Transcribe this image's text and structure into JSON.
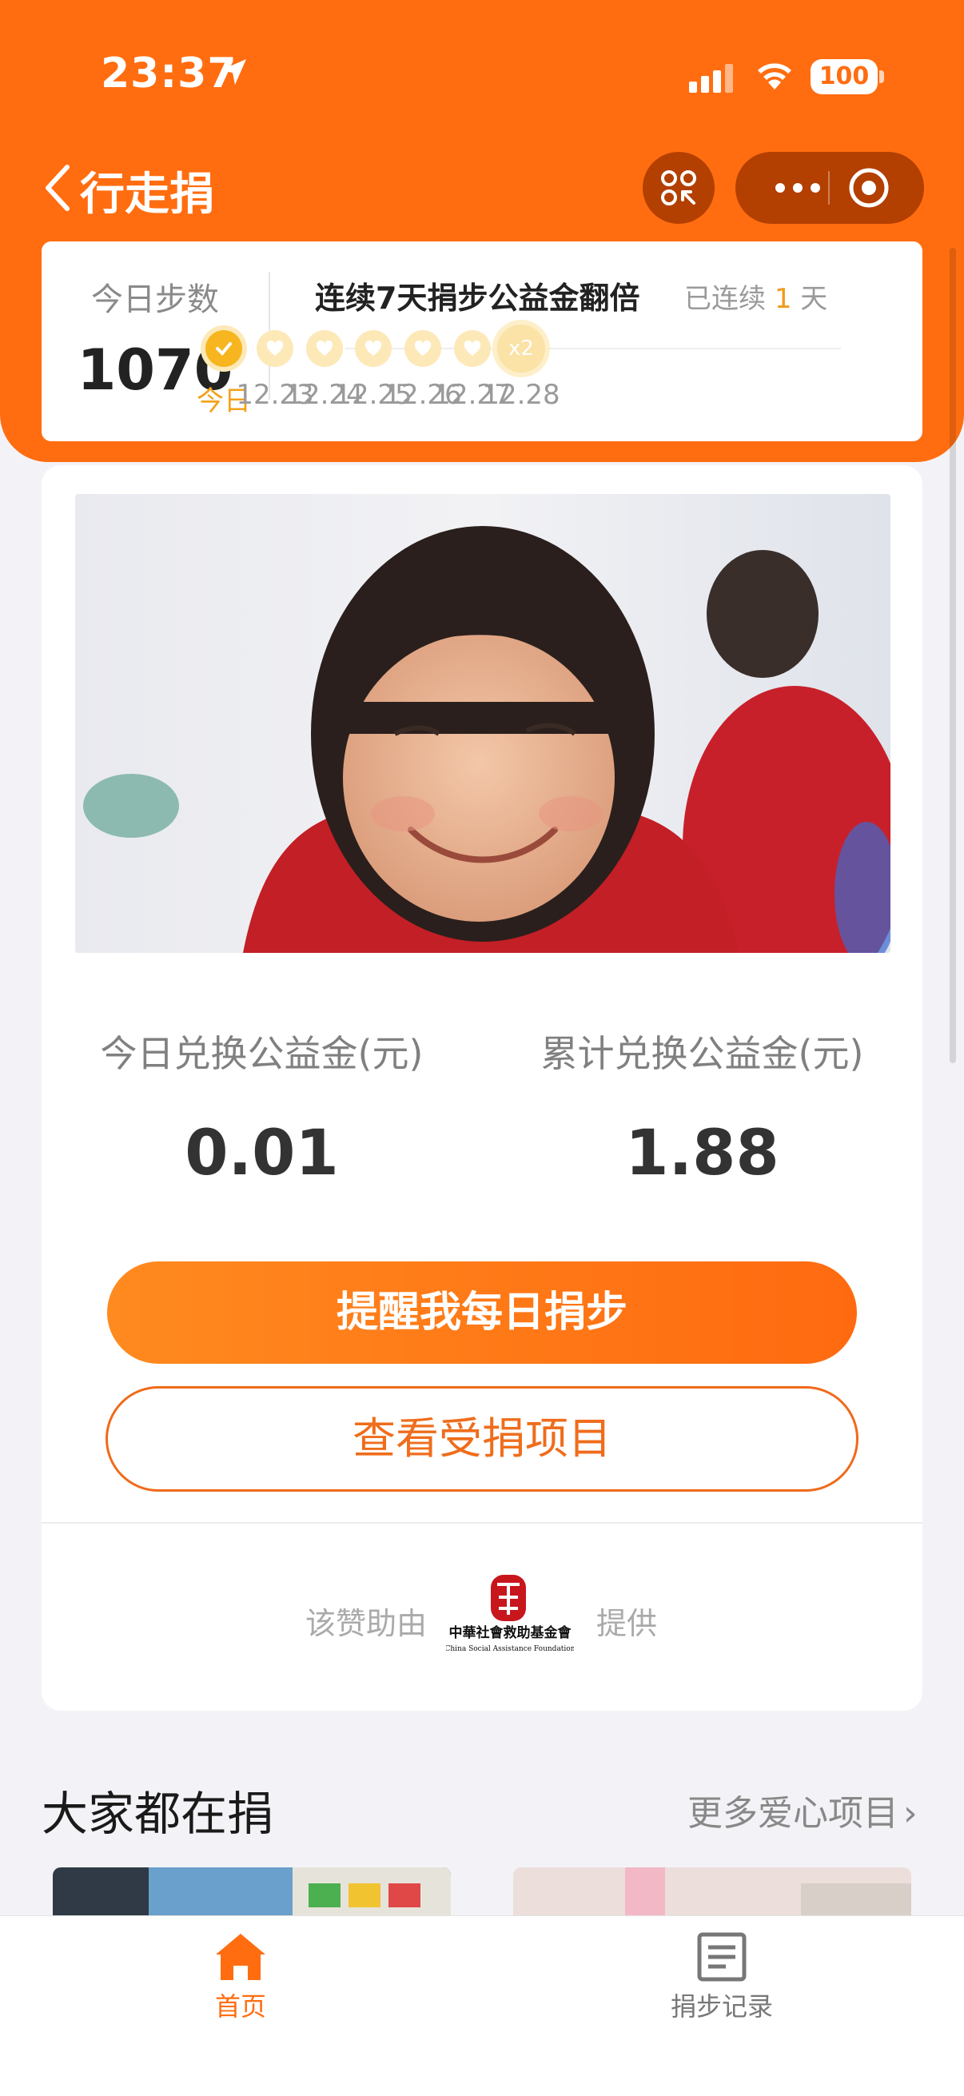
{
  "colors": {
    "brand": "#ff6d10",
    "accent_gold": "#f7b520",
    "text_dark": "#222222"
  },
  "status_bar": {
    "time": "23:37",
    "battery": "100"
  },
  "nav": {
    "title": "行走捐"
  },
  "steps": {
    "label": "今日步数",
    "value": "1070",
    "streak_title": "连续7天捐步公益金翻倍",
    "streak_prefix": "已连续",
    "streak_days": "1",
    "streak_suffix": "天",
    "x2_badge": "x2",
    "days": [
      "今日",
      "12.23",
      "12.24",
      "12.25",
      "12.26",
      "12.27",
      "12.28"
    ]
  },
  "stats": {
    "today_label": "今日兑换公益金(元)",
    "today_value": "0.01",
    "total_label": "累计兑换公益金(元)",
    "total_value": "1.88"
  },
  "buttons": {
    "remind": "提醒我每日捐步",
    "view_projects": "查看受捐项目"
  },
  "provider": {
    "prefix": "该赞助由",
    "suffix": "提供",
    "logo_name": "中華社會救助基金會",
    "logo_en": "China Social Assistance Foundation"
  },
  "section": {
    "title": "大家都在捐",
    "more": "更多爱心项目"
  },
  "tabs": {
    "home": "首页",
    "records": "捐步记录"
  }
}
